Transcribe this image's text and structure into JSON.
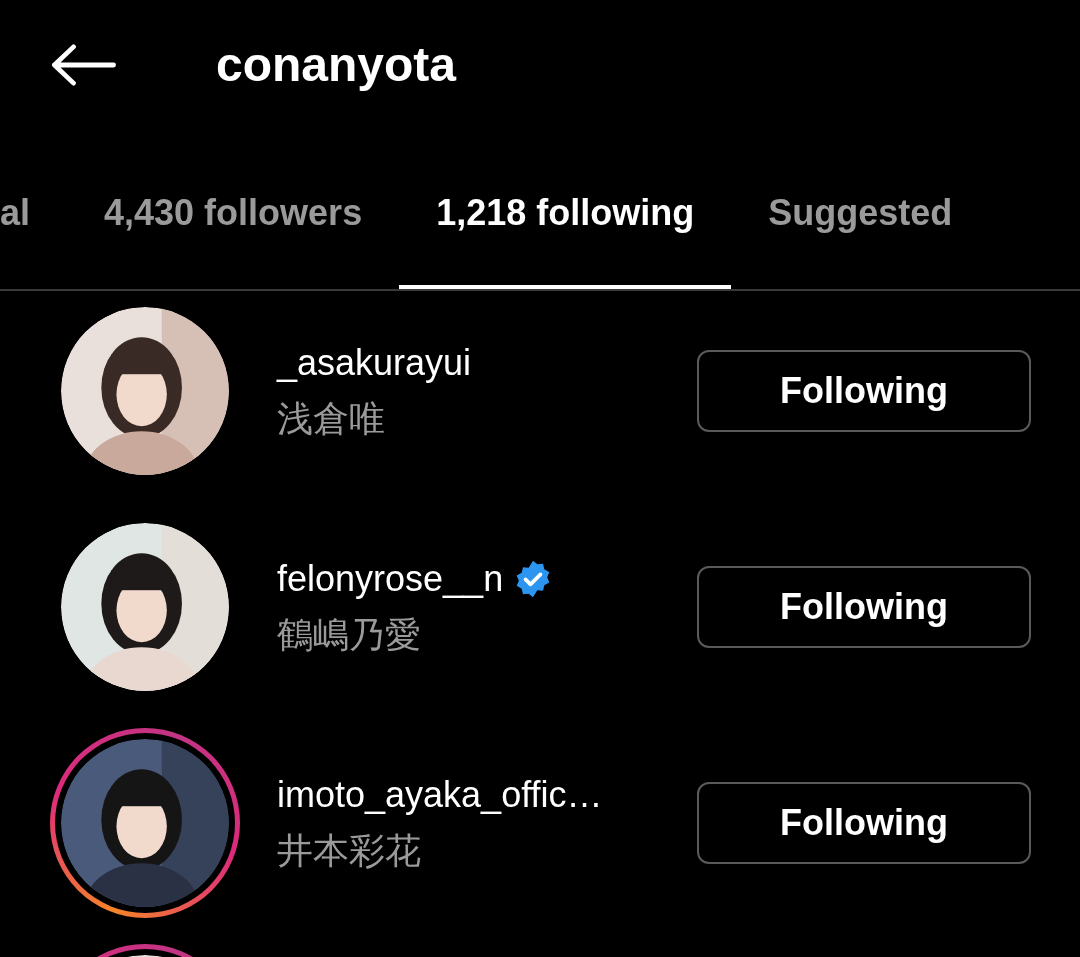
{
  "header": {
    "title": "conanyota"
  },
  "tabs": [
    {
      "label": "al",
      "selected": false
    },
    {
      "label": "4,430 followers",
      "selected": false
    },
    {
      "label": "1,218 following",
      "selected": true
    },
    {
      "label": "Suggested",
      "selected": false
    }
  ],
  "accounts": [
    {
      "username": "_asakurayui",
      "full_name": "浅倉唯",
      "verified": false,
      "story": false,
      "button": "Following"
    },
    {
      "username": "felonyrose__n",
      "full_name": "鶴嶋乃愛",
      "verified": true,
      "story": false,
      "button": "Following"
    },
    {
      "username": "imoto_ayaka_offic…",
      "full_name": "井本彩花",
      "verified": false,
      "story": true,
      "button": "Following"
    },
    {
      "story": true
    }
  ]
}
